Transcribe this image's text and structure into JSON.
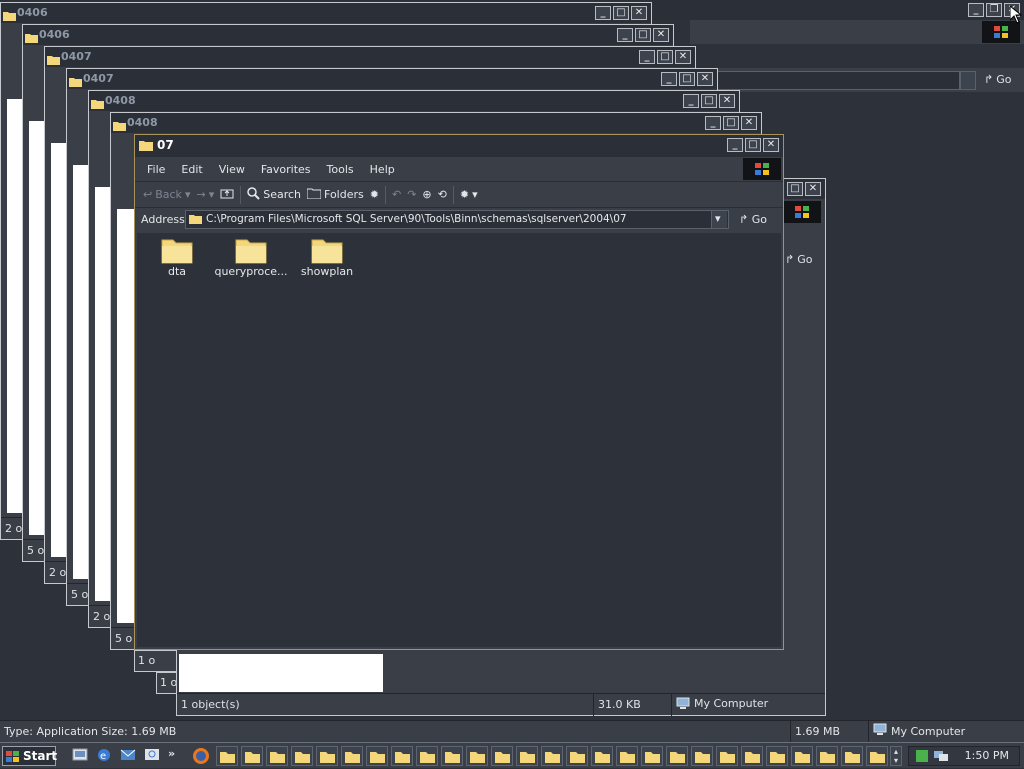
{
  "main_window": {
    "title": "07",
    "menu": [
      "File",
      "Edit",
      "View",
      "Favorites",
      "Tools",
      "Help"
    ],
    "toolbar": {
      "back": "Back",
      "search": "Search",
      "folders": "Folders"
    },
    "address": {
      "label": "Address",
      "value": "C:\\Program Files\\Microsoft SQL Server\\90\\Tools\\Binn\\schemas\\sqlserver\\2004\\07",
      "go": "Go"
    },
    "items": [
      {
        "name": "dta"
      },
      {
        "name": "queryproce..."
      },
      {
        "name": "showplan"
      }
    ]
  },
  "back_windows": [
    {
      "title": "0406",
      "status": "2 o"
    },
    {
      "title": "0406",
      "status": "5 o"
    },
    {
      "title": "0407",
      "status": "2 o"
    },
    {
      "title": "0407",
      "status": "5 o"
    },
    {
      "title": "0408",
      "status": "2 o"
    },
    {
      "title": "0408",
      "status": "5 o"
    }
  ],
  "stack_status": [
    "1 o",
    "1 o"
  ],
  "right_window": {
    "go": "Go",
    "status_objects": "1 object(s)",
    "status_size": "31.0 KB",
    "status_location": "My Computer"
  },
  "top_window": {
    "go": "Go"
  },
  "statusbar": {
    "info": "Type: Application Size: 1.69 MB",
    "size": "1.69 MB",
    "location": "My Computer"
  },
  "taskbar": {
    "start": "Start",
    "overflow": "»",
    "clock": "1:50 PM"
  },
  "colors": {
    "title_bar": "#2b3038",
    "window_bg": "#3a3f47",
    "folder_yellow": "#f3d77a",
    "active_border": "#a8935a"
  }
}
